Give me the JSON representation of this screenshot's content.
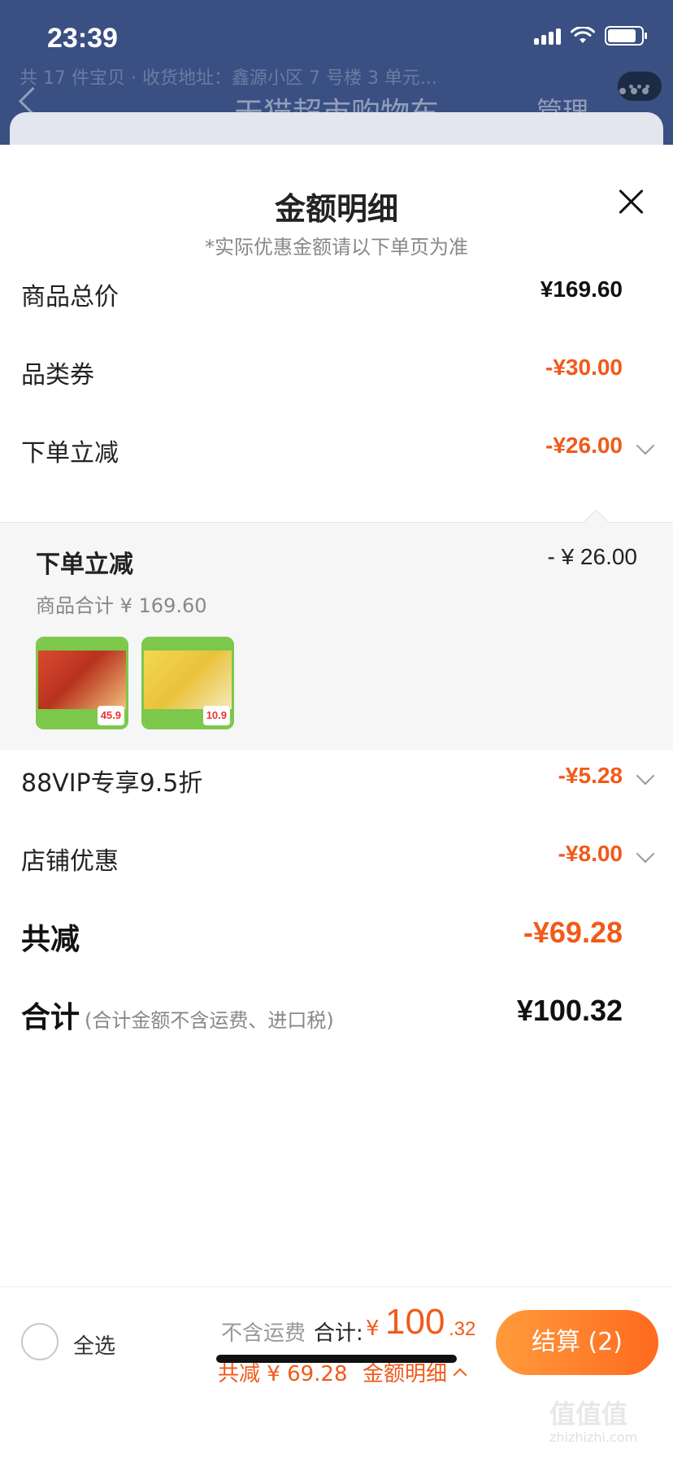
{
  "status_bar": {
    "time": "23:39"
  },
  "background": {
    "subtitle": "共 17 件宝贝 · 收货地址：鑫源小区 7 号楼 3 单元...",
    "nav_title": "天猫超市购物车",
    "manage_label": "管理"
  },
  "sheet": {
    "title": "金额明细",
    "subtitle": "*实际优惠金额请以下单页为准",
    "rows": [
      {
        "label": "商品总价",
        "value": "¥169.60"
      },
      {
        "label": "品类券",
        "value": "-¥30.00"
      },
      {
        "label": "下单立减",
        "value": "-¥26.00"
      },
      {
        "label": "88VIP专享9.5折",
        "value": "-¥5.28"
      },
      {
        "label": "店铺优惠",
        "value": "-¥8.00"
      }
    ],
    "detail": {
      "title": "下单立减",
      "amount": "- ¥ 26.00",
      "subtotal": "商品合计 ¥ 169.60",
      "items": [
        {
          "price": "45.9"
        },
        {
          "price": "10.9"
        }
      ]
    },
    "total_discount": {
      "label": "共减",
      "value": "-¥69.28"
    },
    "grand_total": {
      "label": "合计",
      "note": "(合计金额不含运费、进口税)",
      "value": "¥100.32"
    }
  },
  "bottom_bar": {
    "select_all": "全选",
    "excluding_shipping": "不含运费",
    "total_label": "合计:",
    "currency": "¥",
    "total_int": "100",
    "total_dec": ".32",
    "saved": "共减 ¥ 69.28",
    "detail_link": "金额明细",
    "checkout_label": "结算 (2)"
  },
  "watermark": {
    "text": "值值值",
    "sub": "zhizhizhi.com"
  },
  "colors": {
    "accent": "#f05a1a",
    "header": "#3a4f82"
  }
}
